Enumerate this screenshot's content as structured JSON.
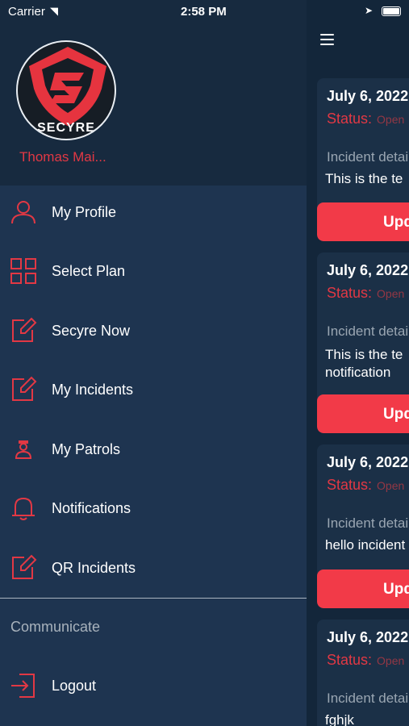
{
  "status_bar": {
    "carrier": "Carrier",
    "time": "2:58 PM"
  },
  "drawer": {
    "brand_text": "SECYRE",
    "user_name": "Thomas Mai...",
    "menu": [
      {
        "label": "My Profile",
        "icon": "person-icon"
      },
      {
        "label": "Select Plan",
        "icon": "grid-icon"
      },
      {
        "label": "Secyre Now",
        "icon": "edit-icon"
      },
      {
        "label": "My Incidents",
        "icon": "edit-icon"
      },
      {
        "label": "My Patrols",
        "icon": "guard-icon"
      },
      {
        "label": "Notifications",
        "icon": "bell-icon"
      },
      {
        "label": "QR Incidents",
        "icon": "edit-icon"
      }
    ],
    "section_label": "Communicate",
    "logout_label": "Logout"
  },
  "incidents": [
    {
      "date": "July 6, 2022",
      "status_label": "Status:",
      "status_value": "Open",
      "detail_label": "Incident details",
      "detail_text": "This is the te",
      "button": "Update"
    },
    {
      "date": "July 6, 2022",
      "status_label": "Status:",
      "status_value": "Open",
      "detail_label": "Incident details",
      "detail_text": "This is the te\nnotification",
      "button": "Update"
    },
    {
      "date": "July 6, 2022",
      "status_label": "Status:",
      "status_value": "Open",
      "detail_label": "Incident details",
      "detail_text": "hello incident",
      "button": "Update"
    },
    {
      "date": "July 6, 2022",
      "status_label": "Status:",
      "status_value": "Open",
      "detail_label": "Incident details",
      "detail_text": "fghjk",
      "button": ""
    }
  ],
  "colors": {
    "accent": "#f23a48",
    "drawer_bg": "#1e3450",
    "header_bg": "#172a3f"
  }
}
